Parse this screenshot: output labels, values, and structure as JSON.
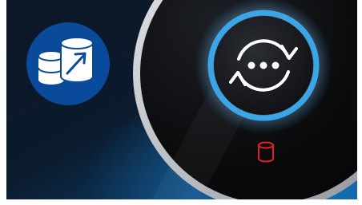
{
  "illustration": {
    "left_badge": {
      "icon": "database-migration-icon",
      "badge_color": "#0a4a9a",
      "icon_color": "#ffffff",
      "arrow_color": "#0a4a9a"
    },
    "sync_button": {
      "icon": "sync-in-progress-icon",
      "ring_color": "#3aa6e8",
      "glyph_color": "#ffffff",
      "dots_count": 3
    },
    "status_indicator": {
      "icon": "database-icon",
      "color": "#e0202a"
    },
    "colors": {
      "background_dark": "#0b1a2c",
      "background_blue": "#0b4f8a",
      "dial_face": "#090a0c",
      "dial_rim": "#c8cbce"
    }
  }
}
